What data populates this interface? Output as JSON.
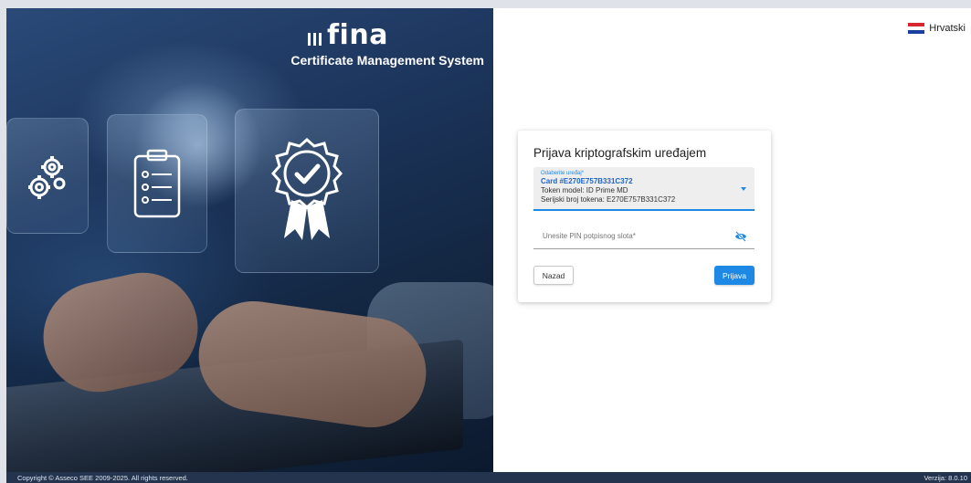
{
  "brand": {
    "logo_text": "fina",
    "subtitle": "Certificate Management System"
  },
  "language": {
    "label": "Hrvatski",
    "flag_icon": "croatia-flag-icon"
  },
  "login": {
    "title": "Prijava kriptografskim uređajem",
    "device_select": {
      "label": "Odaberite uređaj*",
      "value": "Card #E270E757B331C372",
      "token_model": "Token model: ID Prime MD",
      "serial": "Serijski broj tokena: E270E757B331C372"
    },
    "pin_field": {
      "placeholder": "Unesite PIN potpisnog slota*",
      "value": ""
    },
    "back_label": "Nazad",
    "login_label": "Prijava"
  },
  "footer": {
    "copyright": "Copyright © Asseco SEE 2009-2025. All rights reserved.",
    "version": "Verzija: 8.0.10"
  },
  "colors": {
    "accent": "#1e88e5",
    "footer_bg": "#24344f",
    "hero_bg": "#1c355c"
  }
}
